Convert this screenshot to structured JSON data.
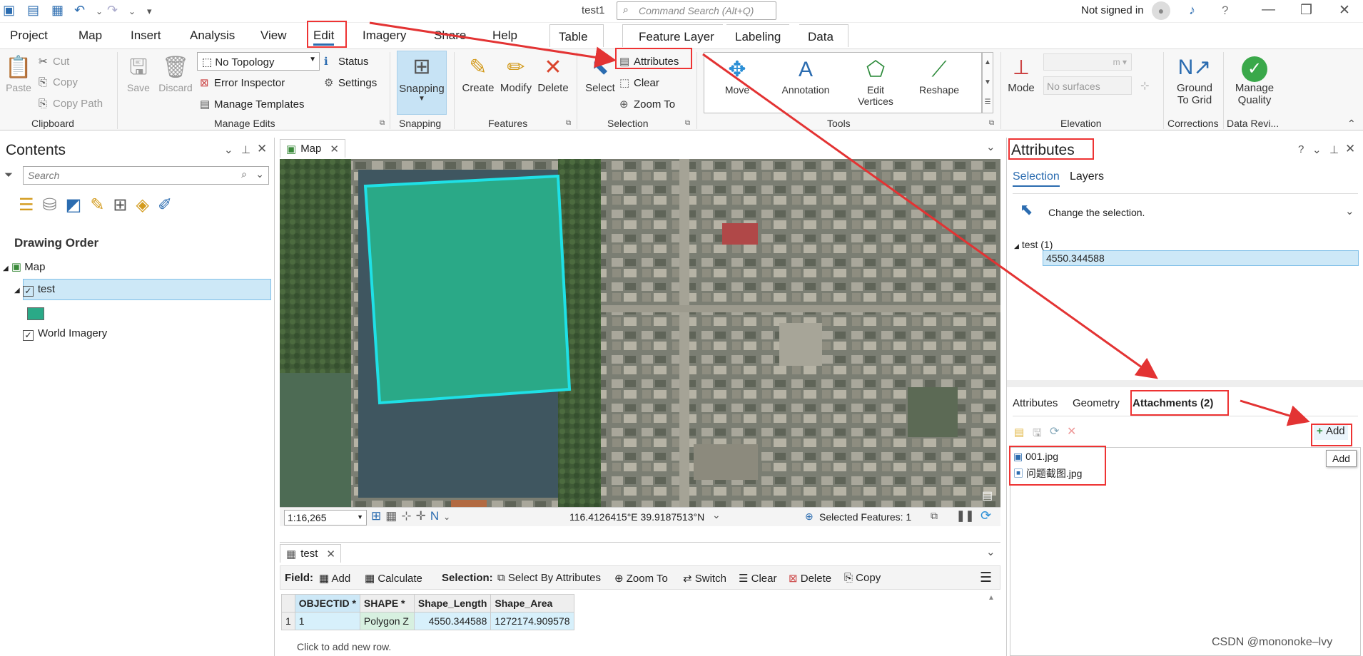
{
  "title_bar": {
    "doc_title": "test1",
    "command_search_placeholder": "Command Search (Alt+Q)",
    "signin": "Not signed in",
    "help": "?"
  },
  "tabs": [
    "Project",
    "Map",
    "Insert",
    "Analysis",
    "View",
    "Edit",
    "Imagery",
    "Share",
    "Help"
  ],
  "context_tabs": {
    "table": "Table",
    "feature_layer": "Feature Layer",
    "labeling": "Labeling",
    "data": "Data"
  },
  "ribbon": {
    "clipboard": {
      "label": "Clipboard",
      "paste": "Paste",
      "cut": "Cut",
      "copy": "Copy",
      "copy_path": "Copy Path"
    },
    "manage_edits": {
      "label": "Manage Edits",
      "save": "Save",
      "discard": "Discard",
      "topology": "No Topology",
      "status": "Status",
      "error_inspector": "Error Inspector",
      "settings": "Settings",
      "manage_templates": "Manage Templates"
    },
    "snapping": {
      "label": "Snapping",
      "button": "Snapping"
    },
    "features": {
      "label": "Features",
      "create": "Create",
      "modify": "Modify",
      "delete": "Delete"
    },
    "selection": {
      "label": "Selection",
      "select": "Select",
      "attributes": "Attributes",
      "clear": "Clear",
      "zoom_to": "Zoom To"
    },
    "tools": {
      "label": "Tools",
      "move": "Move",
      "annotation": "Annotation",
      "edit_vertices_1": "Edit",
      "edit_vertices_2": "Vertices",
      "reshape": "Reshape"
    },
    "elevation": {
      "label": "Elevation",
      "mode": "Mode",
      "surfaces": "No surfaces",
      "unit": "m"
    },
    "corrections": {
      "label": "Corrections",
      "ground_1": "Ground",
      "ground_2": "To Grid"
    },
    "data_reviewer": {
      "label": "Data Revi...",
      "manage_1": "Manage",
      "manage_2": "Quality"
    }
  },
  "contents": {
    "title": "Contents",
    "search_placeholder": "Search",
    "drawing_order": "Drawing Order",
    "map": "Map",
    "layer_test": "test",
    "layer_imagery": "World Imagery"
  },
  "map_view": {
    "tab": "Map",
    "scale": "1:16,265",
    "coords": "116.4126415°E 39.9187513°N",
    "selected": "Selected Features: 1"
  },
  "table_view": {
    "tab": "test",
    "field_label": "Field:",
    "add": "Add",
    "calculate": "Calculate",
    "selection_label": "Selection:",
    "select_by_attributes": "Select By Attributes",
    "zoom_to": "Zoom To",
    "switch": "Switch",
    "clear": "Clear",
    "delete": "Delete",
    "copy": "Copy",
    "columns": [
      "OBJECTID *",
      "SHAPE *",
      "Shape_Length",
      "Shape_Area"
    ],
    "row_index": "1",
    "row": [
      "1",
      "Polygon Z",
      "4550.344588",
      "1272174.909578"
    ],
    "new_row": "Click to add new row."
  },
  "attributes_pane": {
    "title": "Attributes",
    "tab_selection": "Selection",
    "tab_layers": "Layers",
    "change_selection": "Change the selection.",
    "tree_layer": "test (1)",
    "tree_value": "4550.344588",
    "lower_tabs": {
      "attributes": "Attributes",
      "geometry": "Geometry",
      "attachments": "Attachments (2)"
    },
    "add_button": "Add",
    "tooltip": "Add",
    "files": [
      "001.jpg",
      "问题截图.jpg"
    ]
  },
  "watermark": "CSDN @mononoke–lvy",
  "colors": {
    "accent": "#2b6cb0",
    "polygon_fill": "#2aa987",
    "polygon_stroke": "#1fe0e6",
    "highlight": "#cde8f7",
    "annotation_red": "#e33333"
  }
}
